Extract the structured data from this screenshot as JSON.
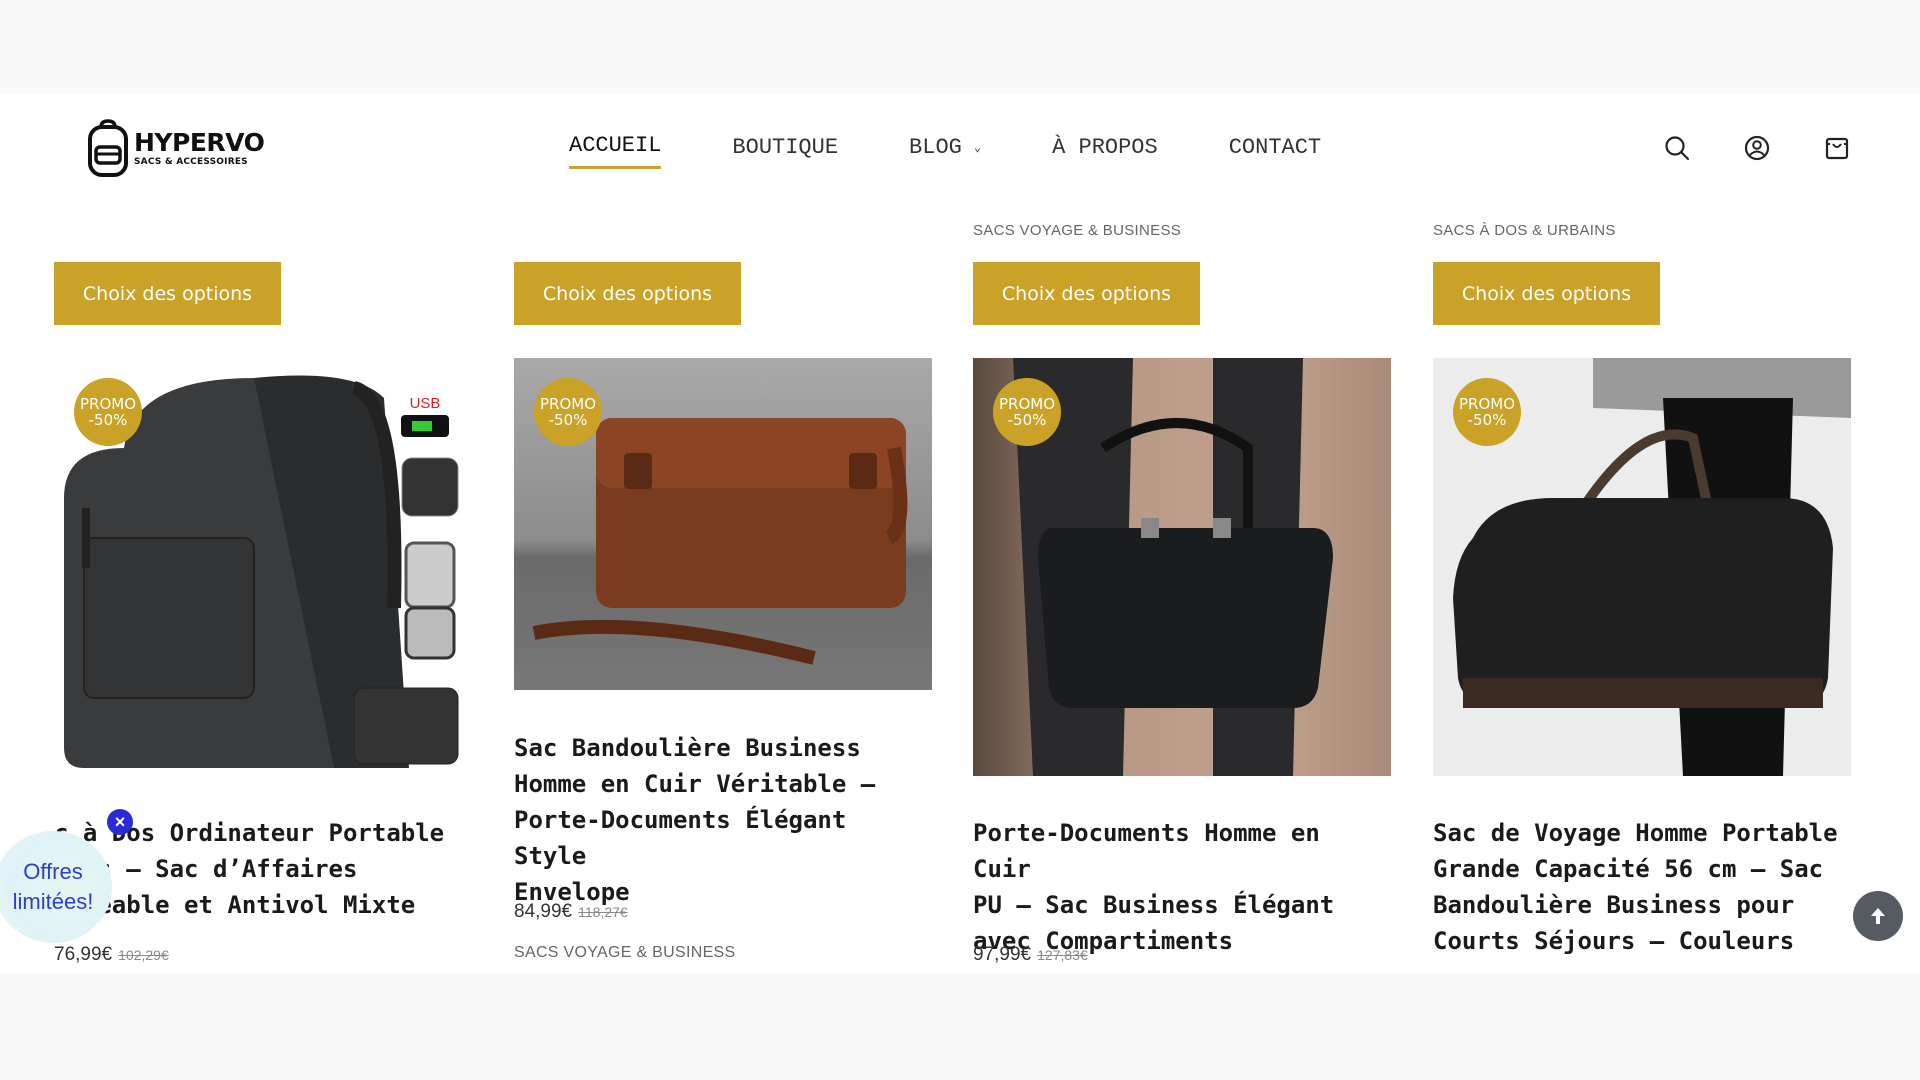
{
  "brand": {
    "name": "HYPERVO",
    "tagline": "SACS & ACCESSOIRES"
  },
  "nav": [
    {
      "label": "ACCUEIL",
      "active": true
    },
    {
      "label": "BOUTIQUE"
    },
    {
      "label": "BLOG",
      "has_dropdown": true
    },
    {
      "label": "À PROPOS"
    },
    {
      "label": "CONTACT"
    }
  ],
  "header_icons": [
    "search-icon",
    "account-icon",
    "cart-icon"
  ],
  "accent_color": "#c9a227",
  "top_row": {
    "button_label": "Choix des options",
    "categories": [
      "",
      "",
      "SACS VOYAGE & BUSINESS",
      "SACS À DOS & URBAINS"
    ]
  },
  "products": [
    {
      "promo": [
        "PROMO",
        "-50%"
      ],
      "title": "c à Dos Ordinateur Portable\nness – Sac d’Affaires\nerméable et Antivol Mixte",
      "price": "76,99€",
      "old_price": "102,29€",
      "category": "",
      "image": "backpack-gray",
      "image_text": "USB"
    },
    {
      "promo": [
        "PROMO",
        "-50%"
      ],
      "title": "Sac Bandoulière Business\nHomme en Cuir Véritable –\nPorte-Documents Élégant Style\nEnvelope",
      "price": "84,99€",
      "old_price": "118,27€",
      "category": "SACS VOYAGE & BUSINESS",
      "image": "leather-envelope-brown"
    },
    {
      "promo": [
        "PROMO",
        "-50%"
      ],
      "title": "Porte-Documents Homme en Cuir\nPU – Sac Business Élégant\navec Compartiments",
      "price": "97,99€",
      "old_price": "127,83€",
      "category": "",
      "image": "briefcase-black"
    },
    {
      "promo": [
        "PROMO",
        "-50%"
      ],
      "title": "Sac de Voyage Homme Portable\nGrande Capacité 56 cm – Sac\nBandoulière Business pour\nCourts Séjours – Couleurs",
      "price": "",
      "old_price": "",
      "category": "",
      "image": "duffel-black"
    }
  ],
  "popup": {
    "label": "Offres\nlimitées!"
  }
}
